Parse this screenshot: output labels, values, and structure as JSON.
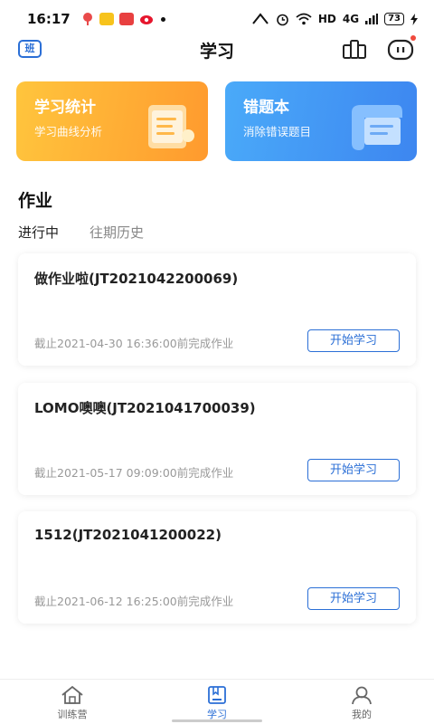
{
  "status_bar": {
    "time": "16:17",
    "network": "HD",
    "signal": "4G",
    "battery": "73"
  },
  "header": {
    "class_badge": "班",
    "title": "学习"
  },
  "features": [
    {
      "title": "学习统计",
      "subtitle": "学习曲线分析"
    },
    {
      "title": "错题本",
      "subtitle": "消除错误题目"
    }
  ],
  "section": {
    "title": "作业",
    "tabs": [
      "进行中",
      "往期历史"
    ]
  },
  "homeworks": [
    {
      "title": "做作业啦(JT2021042200069)",
      "deadline": "截止2021-04-30 16:36:00前完成作业",
      "button": "开始学习"
    },
    {
      "title": "LOMO噢噢(JT2021041700039)",
      "deadline": "截止2021-05-17 09:09:00前完成作业",
      "button": "开始学习"
    },
    {
      "title": "1512(JT2021041200022)",
      "deadline": "截止2021-06-12 16:25:00前完成作业",
      "button": "开始学习"
    }
  ],
  "bottom_nav": [
    {
      "label": "训练营",
      "icon": "house-icon"
    },
    {
      "label": "学习",
      "icon": "book-icon",
      "active": true
    },
    {
      "label": "我的",
      "icon": "user-icon"
    }
  ],
  "colors": {
    "accent": "#2b6fd6",
    "stats_card": "#ffb234",
    "wrong_card": "#4099f5"
  }
}
